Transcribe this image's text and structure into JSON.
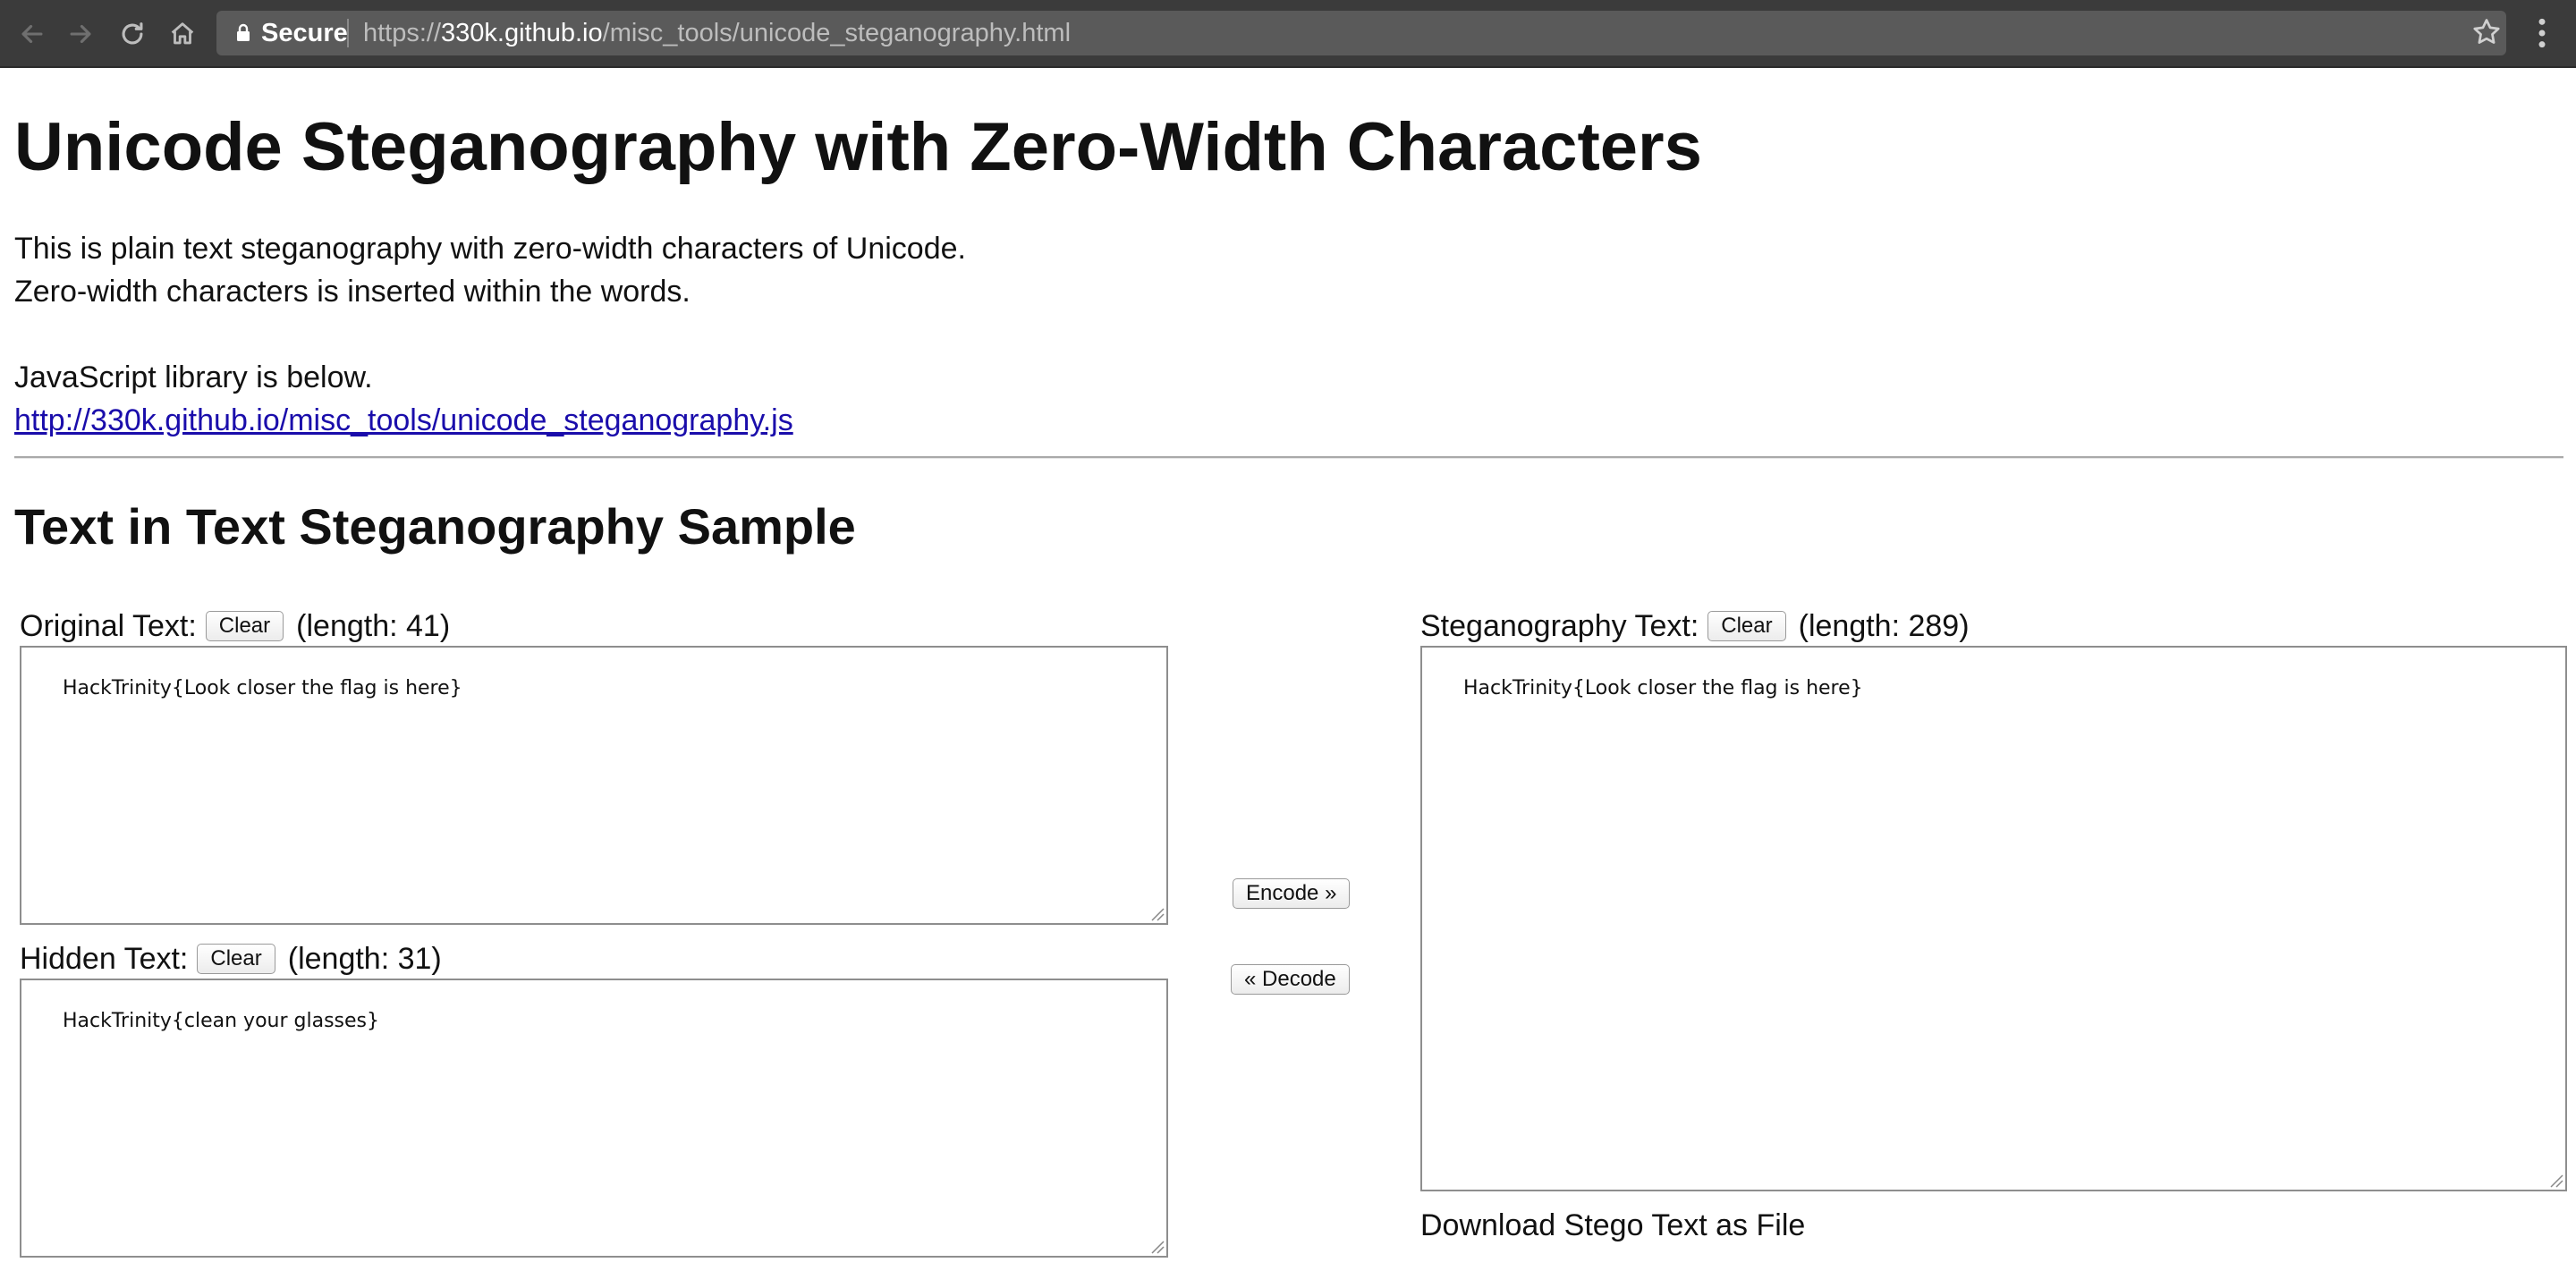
{
  "browser": {
    "secure_label": "Secure",
    "url_scheme": "https://",
    "url_host": "330k.github.io",
    "url_path": "/misc_tools/unicode_steganography.html"
  },
  "page": {
    "title": "Unicode Steganography with Zero-Width Characters",
    "intro_line1": "This is plain text steganography with zero-width characters of Unicode.",
    "intro_line2": "Zero-width characters is inserted within the words.",
    "library_note": "JavaScript library is below.",
    "library_link": "http://330k.github.io/misc_tools/unicode_steganography.js",
    "section_title": "Text in Text Steganography Sample"
  },
  "original": {
    "label": "Original Text:",
    "clear_label": "Clear",
    "length_text": "(length: 41)",
    "value": "HackTrinity{Look closer the flag is here}"
  },
  "hidden": {
    "label": "Hidden Text:",
    "clear_label": "Clear",
    "length_text": "(length: 31)",
    "value": "HackTrinity{clean your glasses}"
  },
  "stego": {
    "label": "Steganography Text:",
    "clear_label": "Clear",
    "length_text": "(length: 289)",
    "value": "HackTrinity{Look closer the flag is here}",
    "download_label": "Download Stego Text as File"
  },
  "actions": {
    "encode_label": "Encode »",
    "decode_label": "« Decode"
  }
}
